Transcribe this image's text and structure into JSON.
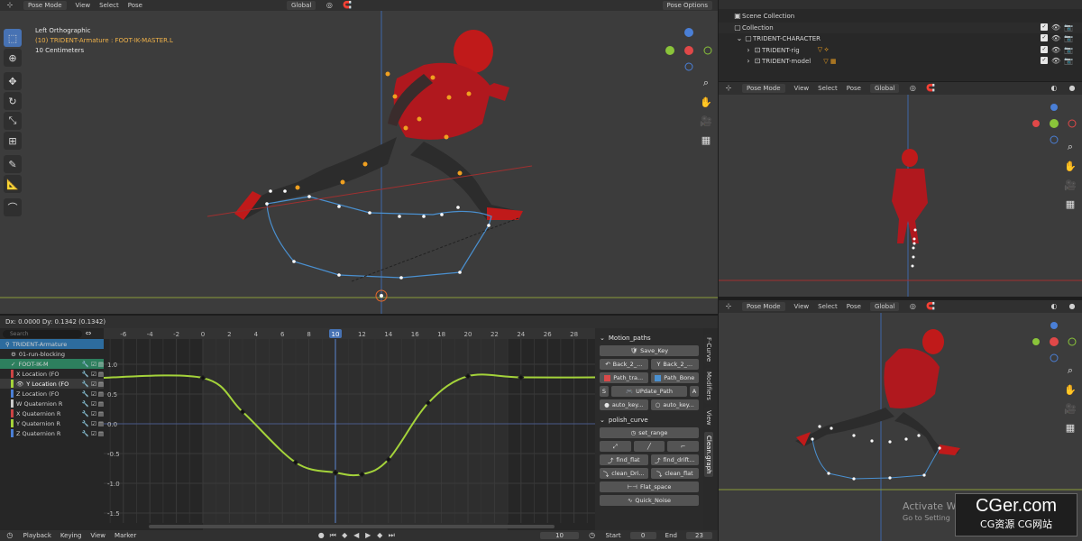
{
  "main_viewport": {
    "header": {
      "mode": "Pose Mode",
      "view": "View",
      "select": "Select",
      "pose": "Pose",
      "orientation": "Global",
      "pose_options": "Pose Options"
    },
    "overlay": {
      "view_name": "Left Orthographic",
      "active": "(10) TRIDENT-Armature : FOOT-IK-MASTER.L",
      "scale": "10 Centimeters"
    }
  },
  "outliner": {
    "rows": [
      {
        "label": "Scene Collection"
      },
      {
        "label": "Collection"
      },
      {
        "label": "TRIDENT-CHARACTER"
      },
      {
        "label": "TRIDENT-rig"
      },
      {
        "label": "TRIDENT-model"
      }
    ]
  },
  "side_viewport_top": {
    "mode": "Pose Mode",
    "view": "View",
    "select": "Select",
    "pose": "Pose",
    "orientation": "Global"
  },
  "side_viewport_bottom": {
    "mode": "Pose Mode",
    "view": "View",
    "select": "Select",
    "pose": "Pose",
    "orientation": "Global"
  },
  "graph_editor": {
    "status": "Dx: 0.0000   Dy: 0.1342 (0.1342)",
    "search_placeholder": "Search",
    "channels": [
      {
        "label": "TRIDENT-Armature",
        "color": "#2d6c9e"
      },
      {
        "label": "01-run-blocking",
        "color": ""
      },
      {
        "label": "FOOT-IK-M",
        "color": "#2d7f5e"
      },
      {
        "label": "X Location (FO",
        "color": "#c44"
      },
      {
        "label": "Y Location (FO",
        "color": "#a4d33a"
      },
      {
        "label": "Z Location (FO",
        "color": "#4a7fd6"
      },
      {
        "label": "W Quaternion R",
        "color": "#c9c9c9"
      },
      {
        "label": "X Quaternion R",
        "color": "#c44"
      },
      {
        "label": "Y Quaternion R",
        "color": "#a4d33a"
      },
      {
        "label": "Z Quaternion R",
        "color": "#4a7fd6"
      }
    ],
    "x_ticks": [
      "-6",
      "-4",
      "-2",
      "0",
      "2",
      "4",
      "6",
      "8",
      "10",
      "12",
      "14",
      "16",
      "18",
      "20",
      "22",
      "24",
      "26",
      "28"
    ],
    "current_frame": "10",
    "y_ticks": [
      "1.0",
      "0.5",
      "0.0",
      "-0.5",
      "-1.0",
      "-1.5"
    ],
    "curve_color": "#a4d33a"
  },
  "chart_data": {
    "type": "line",
    "x": [
      -8,
      0,
      3,
      7,
      10,
      12,
      14,
      17,
      20,
      24,
      30
    ],
    "series": [
      {
        "values": [
          0.77,
          0.77,
          0.2,
          -0.65,
          -0.82,
          -0.85,
          -0.6,
          0.35,
          0.8,
          0.78,
          0.78
        ]
      }
    ],
    "xlim": [
      -8,
      30
    ],
    "ylim": [
      -1.7,
      1.25
    ]
  },
  "n_panel": {
    "motion_paths_title": "Motion_paths",
    "save_key": "Save_Key",
    "back_2a": "Back_2_...",
    "back_2b": "Back_2_...",
    "path_tra": "Path_tra...",
    "path_bone": "Path_Bone",
    "update_path": "UPdate_Path",
    "auto_key_a": "auto_key...",
    "auto_key_b": "auto_key...",
    "polish_title": "polish_curve",
    "set_range": "set_range",
    "find_flat": "find_flat",
    "find_drift": "find_drift...",
    "clean_dri": "clean_Dri...",
    "clean_flat": "clean_flat",
    "flat_space": "Flat_space",
    "quick_noise": "Quick_Noise",
    "tabs": [
      "F-Curve",
      "Modifiers",
      "View",
      "Clean.graph"
    ]
  },
  "timeline": {
    "playback": "Playback",
    "keying": "Keying",
    "view": "View",
    "marker": "Marker",
    "current": "10",
    "start_label": "Start",
    "start": "0",
    "end_label": "End",
    "end": "23"
  },
  "watermark": {
    "activate_1": "Activate W",
    "activate_2": "Go to Setting",
    "brand": "CGer.com",
    "brand_sub": "CG资源 CG网站"
  }
}
